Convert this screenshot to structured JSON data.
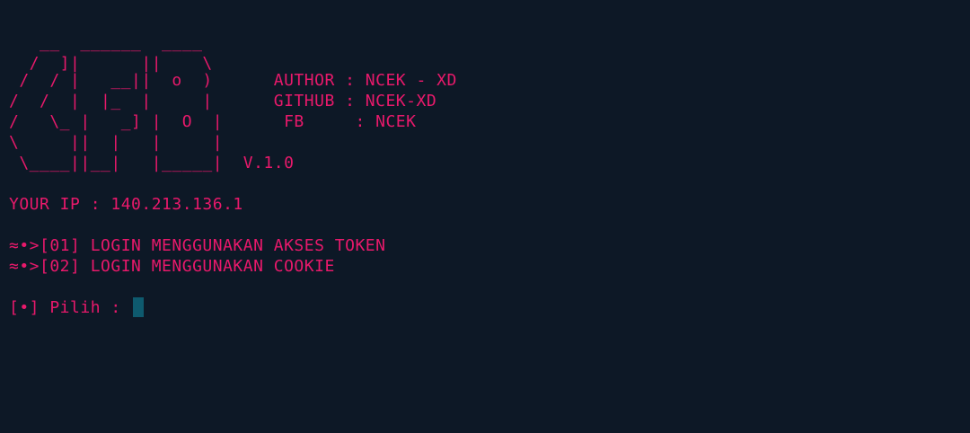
{
  "banner": [
    "   __  ______  ____",
    "  /  ]|      ||    \\",
    " /  / |   __||  o  )      AUTHOR : NCEK - XD",
    "/  /  |  |_  |     |      GITHUB : NCEK-XD",
    "/   \\_ |   _] |  O  |      FB     : NCEK",
    "\\     ||  |   |     |",
    " \\____||__|   |_____|  V.1.0"
  ],
  "ip_line": "YOUR IP : 140.213.136.1",
  "menu": [
    "≈•>[01] LOGIN MENGGUNAKAN AKSES TOKEN",
    "≈•>[02] LOGIN MENGGUNAKAN COOKIE"
  ],
  "prompt": "[•] Pilih : ",
  "colors": {
    "background": "#0d1826",
    "text": "#e8196b",
    "cursor": "#0e5a6e"
  }
}
